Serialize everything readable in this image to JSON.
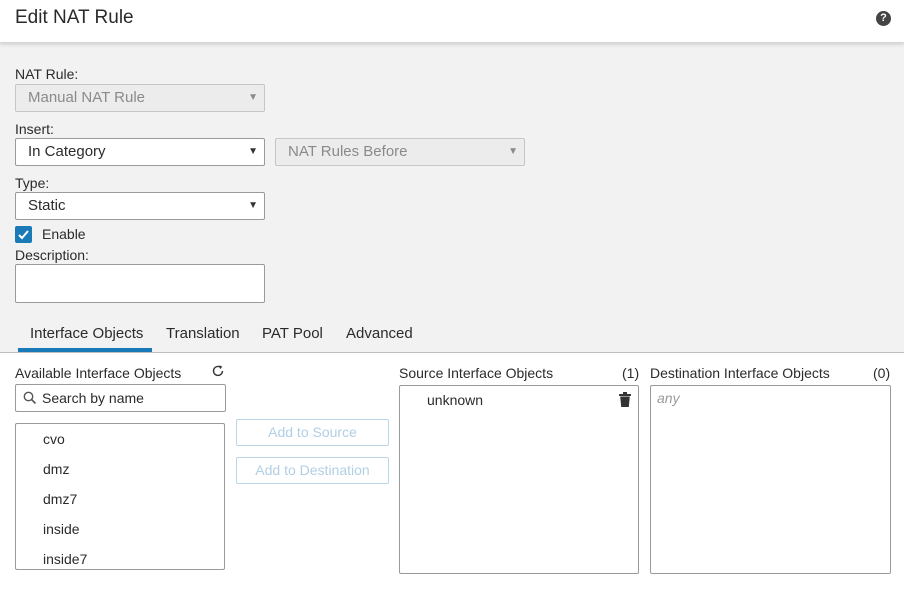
{
  "dialog": {
    "title": "Edit NAT Rule",
    "help_glyph": "?"
  },
  "form": {
    "nat_rule": {
      "label": "NAT Rule:",
      "value": "Manual NAT Rule"
    },
    "insert": {
      "label": "Insert:",
      "value": "In Category",
      "position_value": "NAT Rules Before"
    },
    "type": {
      "label": "Type:",
      "value": "Static"
    },
    "enable": {
      "label": "Enable",
      "checked": true
    },
    "description": {
      "label": "Description:",
      "value": ""
    }
  },
  "tabs": [
    {
      "label": "Interface Objects",
      "active": true
    },
    {
      "label": "Translation",
      "active": false
    },
    {
      "label": "PAT Pool",
      "active": false
    },
    {
      "label": "Advanced",
      "active": false
    }
  ],
  "available": {
    "title": "Available Interface Objects",
    "search_placeholder": "Search by name",
    "items": [
      "cvo",
      "dmz",
      "dmz7",
      "inside",
      "inside7"
    ]
  },
  "actions": {
    "add_source": "Add to Source",
    "add_destination": "Add to Destination"
  },
  "source": {
    "title": "Source Interface Objects",
    "count": "(1)",
    "items": [
      "unknown"
    ]
  },
  "destination": {
    "title": "Destination Interface Objects",
    "count": "(0)",
    "placeholder": "any"
  },
  "colors": {
    "accent": "#1a7ab8",
    "disabled_button_text": "#b1cfe5"
  },
  "icons": {
    "help": "help-icon",
    "refresh": "refresh-icon",
    "search": "search-icon",
    "trash": "trash-icon",
    "dropdown": "chevron-down-icon"
  }
}
